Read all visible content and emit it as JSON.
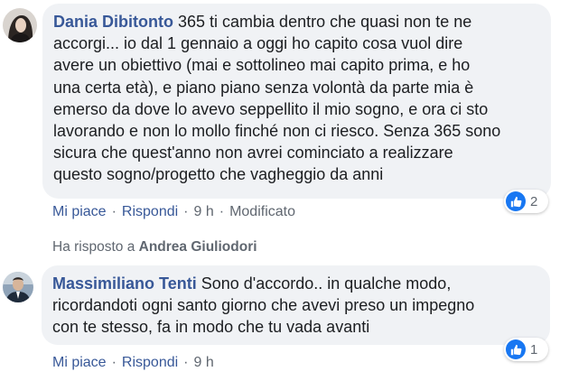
{
  "comments": [
    {
      "author": "Dania Dibitonto",
      "text_lines": [
        " 365 ti cambia dentro che quasi non te ne",
        "accorgi... io dal 1 gennaio a oggi ho capito cosa vuol dire",
        "avere un obiettivo (mai e sottolineo mai capito prima, e ho",
        "una certa età), e piano piano senza volontà da parte mia è",
        "emerso da dove lo avevo seppellito il mio sogno, e ora ci sto",
        "lavorando e non lo mollo finché non ci riesco. Senza 365 sono",
        "sicura che quest'anno non avrei cominciato a realizzare",
        "questo sogno/progetto che vagheggio da anni"
      ],
      "like_label": "Mi piace",
      "reply_label": "Rispondi",
      "time": "9 h",
      "edited_label": "Modificato",
      "reaction_count": "2"
    },
    {
      "author": "Massimiliano Tenti",
      "text_lines": [
        " Sono d'accordo.. in qualche modo,",
        "ricordandoti ogni santo giorno che avevi preso un impegno",
        "con te stesso, fa in modo che tu vada avanti"
      ],
      "like_label": "Mi piace",
      "reply_label": "Rispondi",
      "time": "9 h",
      "reaction_count": "1"
    }
  ],
  "reply_notice": {
    "prefix": "Ha risposto a ",
    "name": "Andrea Giuliodori"
  },
  "separator": "·",
  "colors": {
    "link": "#385898",
    "bubble": "#f0f2f5",
    "like_blue": "#1877f2"
  }
}
